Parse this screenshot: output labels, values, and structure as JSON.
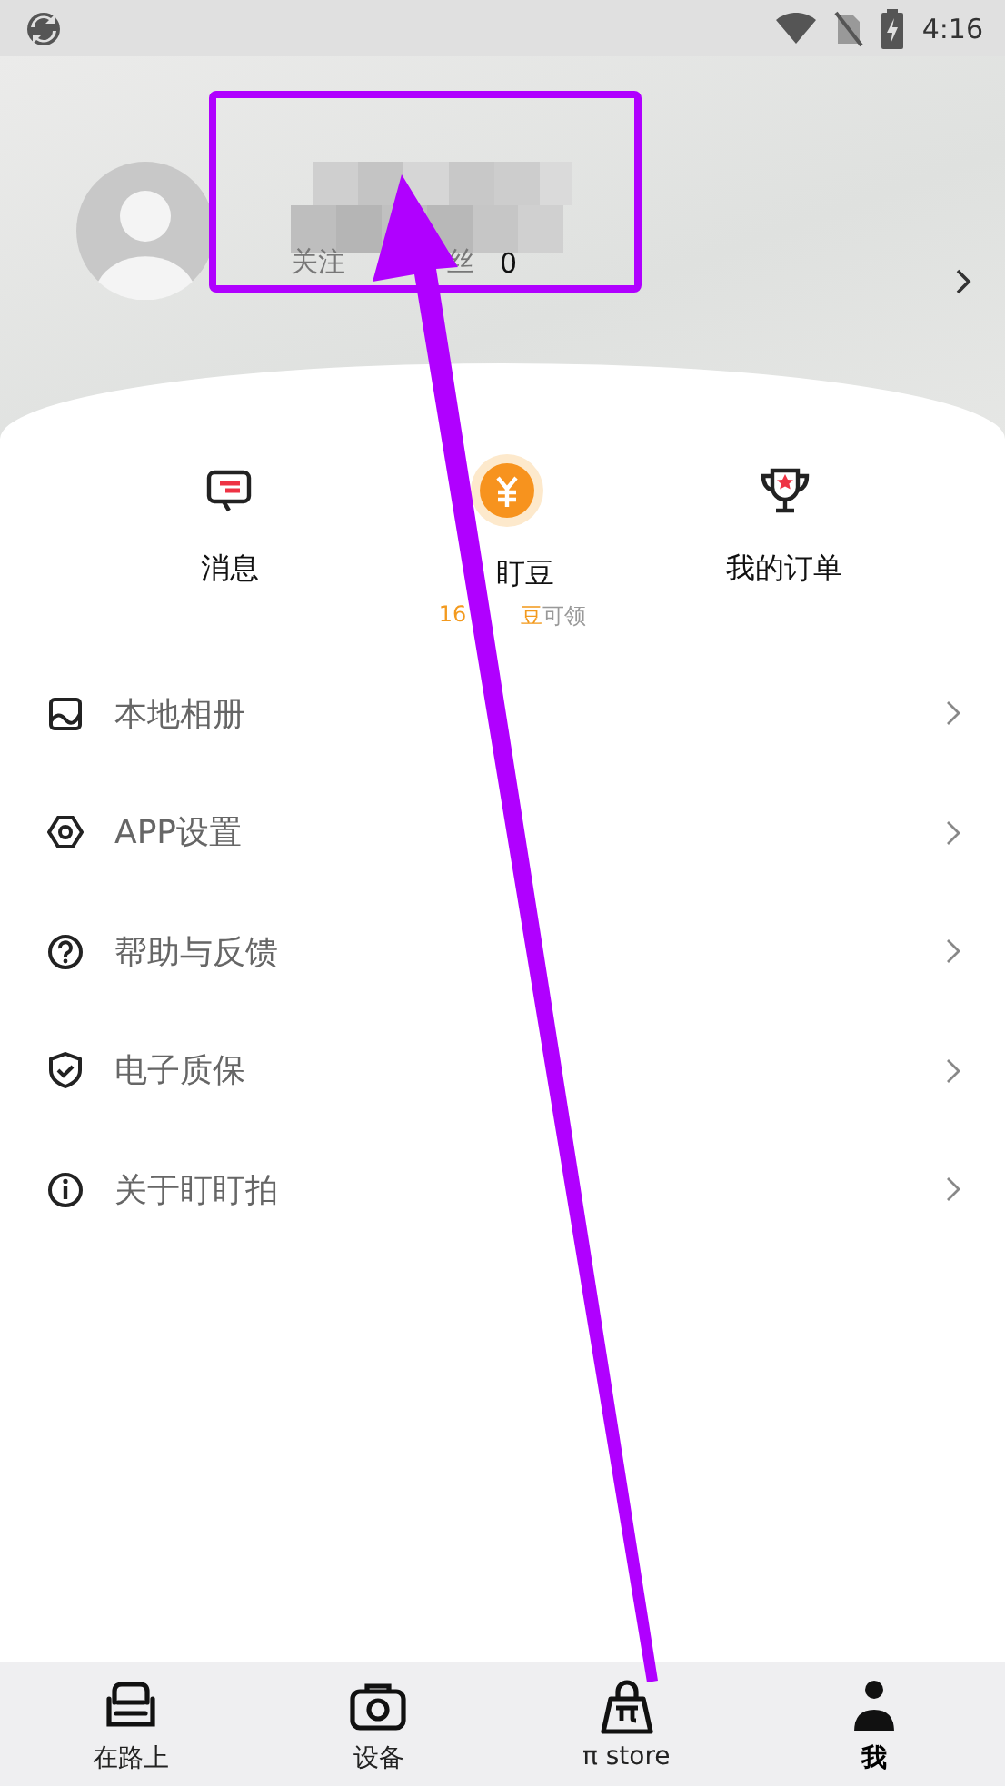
{
  "status_bar": {
    "time": "4:16"
  },
  "profile": {
    "following_label": "关注",
    "followers_label": "丝",
    "followers_count": "0"
  },
  "shortcuts": [
    {
      "kind": "message",
      "label": "消息"
    },
    {
      "kind": "coin",
      "label": "盯豆",
      "sub_amount": "16",
      "sub_unit": "豆可领"
    },
    {
      "kind": "trophy",
      "label": "我的订单"
    }
  ],
  "menu": [
    {
      "kind": "album",
      "label": "本地相册"
    },
    {
      "kind": "settings",
      "label": "APP设置"
    },
    {
      "kind": "help",
      "label": "帮助与反馈"
    },
    {
      "kind": "shield",
      "label": "电子质保"
    },
    {
      "kind": "info",
      "label": "关于盯盯拍"
    }
  ],
  "tabs": [
    {
      "kind": "car",
      "label": "在路上",
      "selected": false
    },
    {
      "kind": "camera",
      "label": "设备",
      "selected": false
    },
    {
      "kind": "bag",
      "label": "π store",
      "selected": false
    },
    {
      "kind": "person",
      "label": "我",
      "selected": true
    }
  ],
  "annotations": {
    "highlight_box": true,
    "arrow": true
  }
}
